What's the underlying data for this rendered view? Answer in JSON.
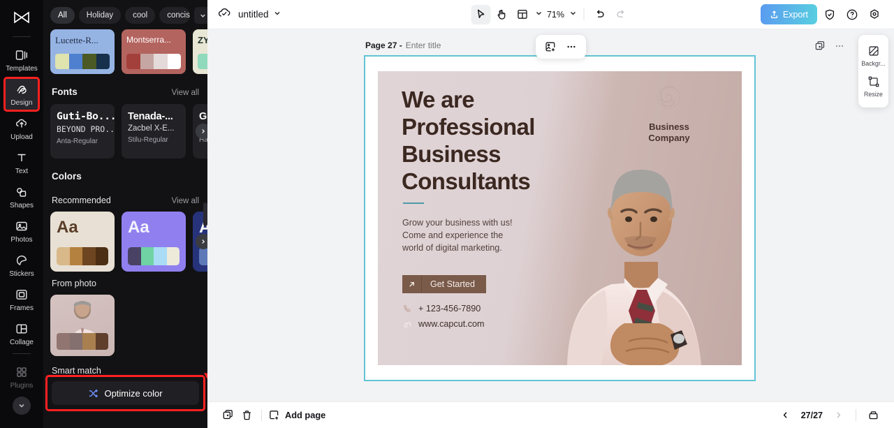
{
  "left_rail": {
    "logo": "capcut-logo-icon",
    "items": [
      {
        "label": "Templates",
        "icon": "templates-icon",
        "active": false,
        "dim": false
      },
      {
        "label": "Design",
        "icon": "design-icon",
        "active": true,
        "dim": false
      },
      {
        "label": "Upload",
        "icon": "upload-cloud-icon",
        "active": false,
        "dim": false
      },
      {
        "label": "Text",
        "icon": "text-icon",
        "active": false,
        "dim": false
      },
      {
        "label": "Shapes",
        "icon": "shapes-icon",
        "active": false,
        "dim": false
      },
      {
        "label": "Photos",
        "icon": "photos-icon",
        "active": false,
        "dim": false
      },
      {
        "label": "Stickers",
        "icon": "stickers-icon",
        "active": false,
        "dim": false
      },
      {
        "label": "Frames",
        "icon": "frames-icon",
        "active": false,
        "dim": false
      },
      {
        "label": "Collage",
        "icon": "collage-icon",
        "active": false,
        "dim": false
      },
      {
        "label": "Plugins",
        "icon": "plugins-icon",
        "active": false,
        "dim": true
      }
    ],
    "expand_icon": "chevron-down-icon",
    "highlight_color": "#ff2020"
  },
  "design_panel": {
    "filters": [
      {
        "label": "All",
        "selected": true
      },
      {
        "label": "Holiday",
        "selected": false
      },
      {
        "label": "cool",
        "selected": false
      },
      {
        "label": "concise",
        "selected": false
      }
    ],
    "filters_more_icon": "chevron-down-icon",
    "templates": [
      {
        "name": "Lucette-R...",
        "bg": "#96b4e3",
        "text_color": "#1e2b45",
        "swatches": [
          "#dfe3ae",
          "#4f7fcf",
          "#4b5a24",
          "#17304b"
        ]
      },
      {
        "name": "Montserra...",
        "bg": "#b4645f",
        "text_color": "#ffffff",
        "swatches": [
          "#a4403c",
          "#c5a6a2",
          "#e4dada",
          "#ffffff"
        ]
      },
      {
        "name": "ZY",
        "bg": "#e8e6d4",
        "text_color": "#22322a",
        "swatches": [
          "#8fd9bc",
          "#8fd9bc",
          "#8fd9bc",
          "#8fd9bc"
        ]
      }
    ],
    "fonts_section": {
      "title": "Fonts",
      "view_all": "View all"
    },
    "fonts": [
      {
        "line1": "Guti-Bo...",
        "line2": "BEYOND PRO...",
        "line3": "Anta-Regular"
      },
      {
        "line1": "Tenada-...",
        "line2": "Zacbel X-E...",
        "line3": "Stilu-Regular"
      },
      {
        "line1": "Gl",
        "line2": "D",
        "line3": "Ham"
      }
    ],
    "colors_section": {
      "title": "Colors",
      "recommended": "Recommended",
      "view_all": "View all"
    },
    "color_palettes": [
      {
        "sample": "Aa",
        "bg": "#e8e0d4",
        "text_color": "#5a3d27",
        "swatches": [
          "#d9b98a",
          "#b5813f",
          "#6d4520",
          "#4b2e14"
        ]
      },
      {
        "sample": "Aa",
        "bg": "#9080ef",
        "text_color": "#f4f1fe",
        "swatches": [
          "#494264",
          "#6fd3a4",
          "#aadcf5",
          "#eeeada"
        ]
      },
      {
        "sample": "A",
        "bg": "#26337a",
        "text_color": "#ffffff",
        "swatches": [
          "#5d79b8",
          "#5d79b8",
          "#5d79b8",
          "#5d79b8"
        ]
      }
    ],
    "from_photo_label": "From photo",
    "from_photo_swatches": [
      "#917570",
      "#83706f",
      "#a97f50",
      "#5f3e2c"
    ],
    "smart_match_label": "Smart match",
    "optimize_button": {
      "label": "Optimize color",
      "icon": "shuffle-icon"
    },
    "carousel_next_icon": "chevron-right-icon"
  },
  "topbar": {
    "cloud_icon": "cloud-saved-icon",
    "doc_title": "untitled",
    "doc_dropdown_icon": "chevron-down-icon",
    "tools": [
      {
        "name": "select-tool",
        "icon": "cursor-icon",
        "active": true
      },
      {
        "name": "hand-tool",
        "icon": "hand-icon",
        "active": false
      },
      {
        "name": "layout-tool",
        "icon": "layout-icon",
        "active": false
      }
    ],
    "layout_dropdown_icon": "chevron-down-icon",
    "zoom_level": "71%",
    "zoom_dropdown_icon": "chevron-down-icon",
    "undo_icon": "undo-icon",
    "redo_icon": "redo-icon",
    "export_label": "Export",
    "export_icon": "export-icon",
    "export_gradient_from": "#5a9bf0",
    "export_gradient_to": "#58cfe0",
    "shield_icon": "shield-icon",
    "help_icon": "help-circle-icon",
    "settings_icon": "settings-icon"
  },
  "canvas": {
    "page_number": "Page 27 -",
    "title_placeholder": "Enter title",
    "float_tools": [
      {
        "name": "replace-image-button",
        "icon": "image-add-icon"
      },
      {
        "name": "more-options-button",
        "icon": "more-horizontal-icon"
      }
    ],
    "page_tools": [
      {
        "name": "duplicate-page-button",
        "icon": "duplicate-icon"
      },
      {
        "name": "page-more-button",
        "icon": "more-horizontal-icon"
      }
    ],
    "selection_color": "#62c3d4",
    "side_panel": [
      {
        "label": "Backgr...",
        "icon": "background-icon"
      },
      {
        "label": "Resize",
        "icon": "resize-icon"
      }
    ]
  },
  "design": {
    "headline": "We are\nProfessional\nBusiness\nConsultants",
    "headline_lines": [
      "We are",
      "Professional",
      "Business",
      "Consultants"
    ],
    "subcopy_lines": [
      "Grow your business with us!",
      "Come and experience the",
      "world of digital marketing."
    ],
    "cta_label": "Get Started",
    "cta_icon": "arrow-up-right-icon",
    "phone": "+ 123-456-7890",
    "phone_icon": "phone-icon",
    "website": "www.capcut.com",
    "website_icon": "link-icon",
    "brand_name_lines": [
      "Business",
      "Company"
    ],
    "brand_logo_icon": "swan-monogram-icon",
    "accent_color": "#4e9aa8",
    "cta_color": "#7a5a49"
  },
  "bottombar": {
    "duplicate_icon": "duplicate-page-icon",
    "delete_icon": "trash-icon",
    "add_page_label": "Add page",
    "add_page_icon": "add-page-icon",
    "prev_icon": "chevron-left-icon",
    "pager": "27/27",
    "next_icon": "chevron-right-icon",
    "grid_icon": "page-grid-icon"
  }
}
